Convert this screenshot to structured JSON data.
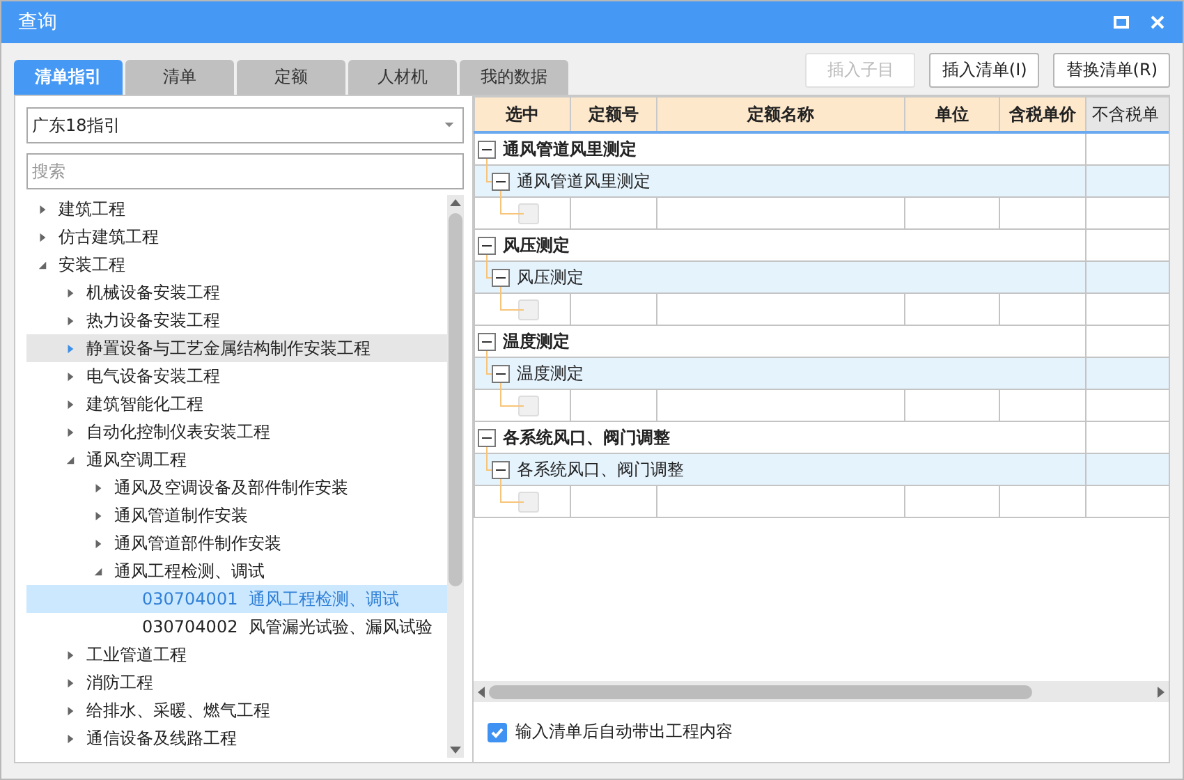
{
  "window": {
    "title": "查询"
  },
  "tabs": [
    {
      "label": "清单指引",
      "selected": true
    },
    {
      "label": "清单",
      "selected": false
    },
    {
      "label": "定额",
      "selected": false
    },
    {
      "label": "人材机",
      "selected": false
    },
    {
      "label": "我的数据",
      "selected": false
    }
  ],
  "toolbar": [
    {
      "label": "插入子目",
      "disabled": true
    },
    {
      "label": "插入清单(I)",
      "disabled": false
    },
    {
      "label": "替换清单(R)",
      "disabled": false
    }
  ],
  "library_select": {
    "value": "广东18指引"
  },
  "search": {
    "placeholder": "搜索"
  },
  "tree": [
    {
      "label": "建筑工程",
      "expanded": false,
      "selected": false,
      "hovered": false
    },
    {
      "label": "仿古建筑工程",
      "expanded": false,
      "selected": false,
      "hovered": false
    },
    {
      "label": "安装工程",
      "expanded": true,
      "selected": false,
      "hovered": false,
      "children": [
        {
          "label": "机械设备安装工程",
          "expanded": false,
          "selected": false,
          "hovered": false
        },
        {
          "label": "热力设备安装工程",
          "expanded": false,
          "selected": false,
          "hovered": false
        },
        {
          "label": "静置设备与工艺金属结构制作安装工程",
          "expanded": false,
          "selected": false,
          "hovered": true
        },
        {
          "label": "电气设备安装工程",
          "expanded": false,
          "selected": false,
          "hovered": false
        },
        {
          "label": "建筑智能化工程",
          "expanded": false,
          "selected": false,
          "hovered": false
        },
        {
          "label": "自动化控制仪表安装工程",
          "expanded": false,
          "selected": false,
          "hovered": false
        },
        {
          "label": "通风空调工程",
          "expanded": true,
          "selected": false,
          "hovered": false,
          "children": [
            {
              "label": "通风及空调设备及部件制作安装",
              "expanded": false,
              "selected": false,
              "hovered": false
            },
            {
              "label": "通风管道制作安装",
              "expanded": false,
              "selected": false,
              "hovered": false
            },
            {
              "label": "通风管道部件制作安装",
              "expanded": false,
              "selected": false,
              "hovered": false
            },
            {
              "label": "通风工程检测、调试",
              "expanded": true,
              "selected": false,
              "hovered": false,
              "children": [
                {
                  "code": "030704001",
                  "label": "通风工程检测、调试",
                  "selected": true,
                  "hovered": false
                },
                {
                  "code": "030704002",
                  "label": "风管漏光试验、漏风试验",
                  "selected": false,
                  "hovered": false
                }
              ]
            }
          ]
        },
        {
          "label": "工业管道工程",
          "expanded": false,
          "selected": false,
          "hovered": false
        },
        {
          "label": "消防工程",
          "expanded": false,
          "selected": false,
          "hovered": false
        },
        {
          "label": "给排水、采暖、燃气工程",
          "expanded": false,
          "selected": false,
          "hovered": false
        },
        {
          "label": "通信设备及线路工程",
          "expanded": false,
          "selected": false,
          "hovered": false
        }
      ]
    }
  ],
  "grid": {
    "columns": [
      "选中",
      "定额号",
      "定额名称",
      "单位",
      "含税单价",
      "不含税单"
    ],
    "groups": [
      {
        "title": "通风管道风里测定",
        "child": "通风管道风里测定",
        "checked": false
      },
      {
        "title": "风压测定",
        "child": "风压测定",
        "checked": false
      },
      {
        "title": "温度测定",
        "child": "温度测定",
        "checked": false
      },
      {
        "title": "各系统风口、阀门调整",
        "child": "各系统风口、阀门调整",
        "checked": false
      }
    ]
  },
  "auto_fill": {
    "label": "输入清单后自动带出工程内容",
    "checked": true
  }
}
